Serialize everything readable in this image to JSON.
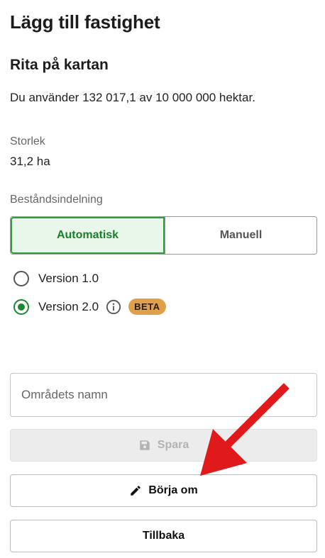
{
  "header": {
    "title": "Lägg till fastighet"
  },
  "draw_section": {
    "title": "Rita på kartan",
    "usage_text": "Du använder 132 017,1 av 10 000 000 hektar."
  },
  "size": {
    "label": "Storlek",
    "value": "31,2 ha"
  },
  "stand_division": {
    "label": "Beståndsindelning",
    "options": [
      "Automatisk",
      "Manuell"
    ],
    "selected": "Automatisk"
  },
  "versions": {
    "items": [
      {
        "label": "Version 1.0",
        "checked": false
      },
      {
        "label": "Version 2.0",
        "checked": true,
        "badge": "BETA"
      }
    ]
  },
  "name_field": {
    "placeholder": "Områdets namn",
    "value": ""
  },
  "buttons": {
    "save": "Spara",
    "restart": "Börja om",
    "back": "Tillbaka"
  },
  "colors": {
    "accent_green": "#1a8a2a",
    "beta_badge": "#e0a04a",
    "annotation_arrow": "#e0191b"
  },
  "icons": {
    "save": "floppy-disk-icon",
    "restart": "pencil-icon",
    "info": "info-circle-icon"
  }
}
